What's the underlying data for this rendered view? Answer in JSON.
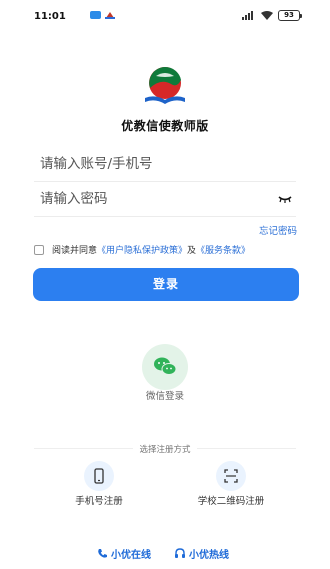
{
  "status_bar": {
    "time": "11:01",
    "battery": "93"
  },
  "app": {
    "name": "优教信使教师版"
  },
  "login_form": {
    "account_placeholder": "请输入账号/手机号",
    "password_placeholder": "请输入密码",
    "forgot_password": "忘记密码",
    "agree_prefix": "阅读并同意",
    "privacy_policy": "《用户隐私保护政策》",
    "agree_and": "及",
    "service_terms": "《服务条款》",
    "login_button": "登录"
  },
  "wechat_login": {
    "label": "微信登录"
  },
  "registration": {
    "title": "选择注册方式",
    "phone_label": "手机号注册",
    "qr_label": "学校二维码注册"
  },
  "support": {
    "online": "小优在线",
    "hotline": "小优热线"
  },
  "colors": {
    "accent": "#2c7ff0",
    "link": "#2b6fd6",
    "wechat": "#31b35a"
  }
}
